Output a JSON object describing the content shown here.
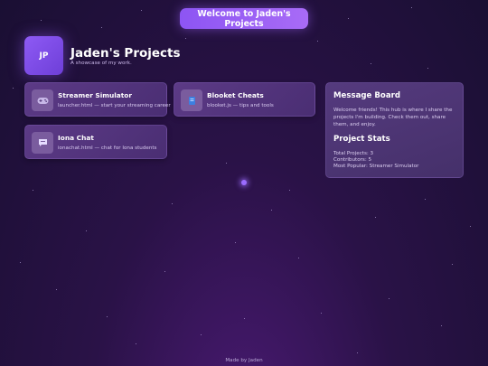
{
  "header": {
    "welcome_button": "Welcome to Jaden's Projects",
    "avatar_initials": "JP",
    "title": "Jaden's Projects",
    "subtitle": "A showcase of my work."
  },
  "projects": [
    {
      "name": "Streamer Simulator",
      "desc": "launcher.html — start your streaming career",
      "icon": "gamepad-icon"
    },
    {
      "name": "Blooket Cheats",
      "desc": "blooket.js — tips and tools",
      "icon": "blue-square-icon"
    },
    {
      "name": "Iona Chat",
      "desc": "ionachat.html — chat for Iona students",
      "icon": "chat-bubble-icon"
    }
  ],
  "message_board": {
    "title": "Message Board",
    "body": "Welcome friends! This hub is where I share the projects I'm building. Check them out, share them, and enjoy."
  },
  "stats": {
    "title": "Project Stats",
    "total_projects": "Total Projects: 3",
    "contributors": "Contributors: 5",
    "most_popular": "Most Popular: Streamer Simulator"
  },
  "footer": "Made by Jaden",
  "colors": {
    "accent": "#9b64f5",
    "background": "#22133d",
    "card": "#533579"
  }
}
